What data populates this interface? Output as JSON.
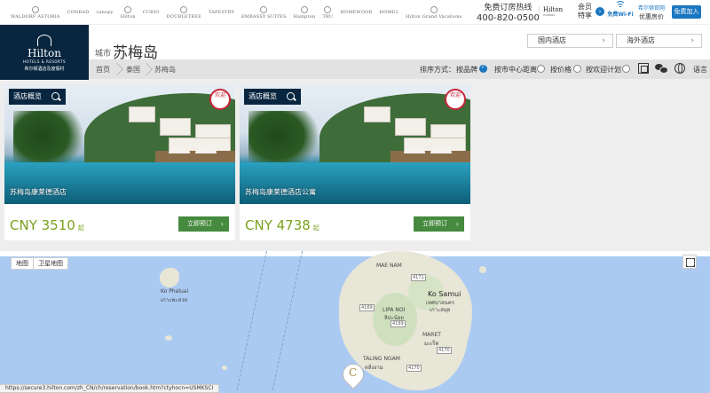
{
  "topbar": {
    "brands": [
      "WALDORF ASTORIA",
      "CONRAD",
      "canopy",
      "Hilton",
      "CURIO",
      "DOUBLETREE",
      "TAPESTRY",
      "EMBASSY SUITES",
      "Hampton",
      "TRU",
      "HOMEWOOD",
      "HOME2",
      "Hilton Grand Vacations"
    ],
    "hotline_label": "免费订房热线",
    "hotline_number": "400-820-0500",
    "honors_brand": "Hilton",
    "honors_sub": "HONORS",
    "member_line1": "会员",
    "member_line2": "特享",
    "member_arrow": "›",
    "wifi_label": "免费Wi-Fi",
    "official_line1": "希尔顿官网",
    "official_line2": "优惠房价",
    "join_label": "免费加入"
  },
  "header": {
    "logo_name": "Hilton",
    "logo_sub1": "HOTELS & RESORTS",
    "logo_sub2": "希尔顿酒店及度假村",
    "city_label": "城市",
    "city_name": "苏梅岛",
    "btn_domestic": "国内酒店",
    "btn_overseas": "海外酒店",
    "chevron": "›"
  },
  "breadcrumb": {
    "items": [
      "首页",
      "泰国",
      "苏梅岛"
    ]
  },
  "sort": {
    "label": "排序方式：",
    "options": [
      "按品牌",
      "按市中心距离",
      "按价格",
      "按欢迎计划"
    ],
    "selected": 0
  },
  "tools": {
    "language_label": "语言"
  },
  "accent": {
    "navy": "#08263f",
    "blue": "#1b76c0",
    "price_green": "#7aa21c",
    "button_green": "#458a3e"
  },
  "cards": [
    {
      "tag": "酒店概览",
      "stamp": "欢迎",
      "name": "苏梅岛康莱德酒店",
      "price": "CNY 3510",
      "price_suffix": "起",
      "book_label": "立即预订",
      "book_chevron": "›"
    },
    {
      "tag": "酒店概览",
      "stamp": "欢迎",
      "name": "苏梅岛康莱德酒店公寓",
      "price": "CNY 4738",
      "price_suffix": "起",
      "book_label": "立即预订",
      "book_chevron": "›"
    }
  ],
  "map": {
    "tab_map": "地图",
    "tab_satellite": "卫星地图",
    "labels": {
      "ko_phaluai": "Ko Phaluai",
      "ko_phaluai_th": "เกาะพะลวย",
      "mae_nam": "MAE NAM",
      "ko_samui": "Ko Samui",
      "ko_samui_th1": "เทศบาลนคร",
      "ko_samui_th2": "เกาะสมุย",
      "lipa_noi": "LIPA NOI",
      "lipa_noi_th": "ลิปะน้อย",
      "maret": "MARET",
      "maret_th": "มะเร็ต",
      "taling_ngam": "TALING NGAM",
      "taling_ngam_th": "ตลิ่งงาม"
    },
    "roads": [
      "4171",
      "4169",
      "4169",
      "4170",
      "4170"
    ],
    "pin_letter": "C"
  },
  "status": {
    "url": "https://secure3.hilton.com/zh_CN/ch/reservation/book.htm?ctyhocn=USMKSCI"
  }
}
